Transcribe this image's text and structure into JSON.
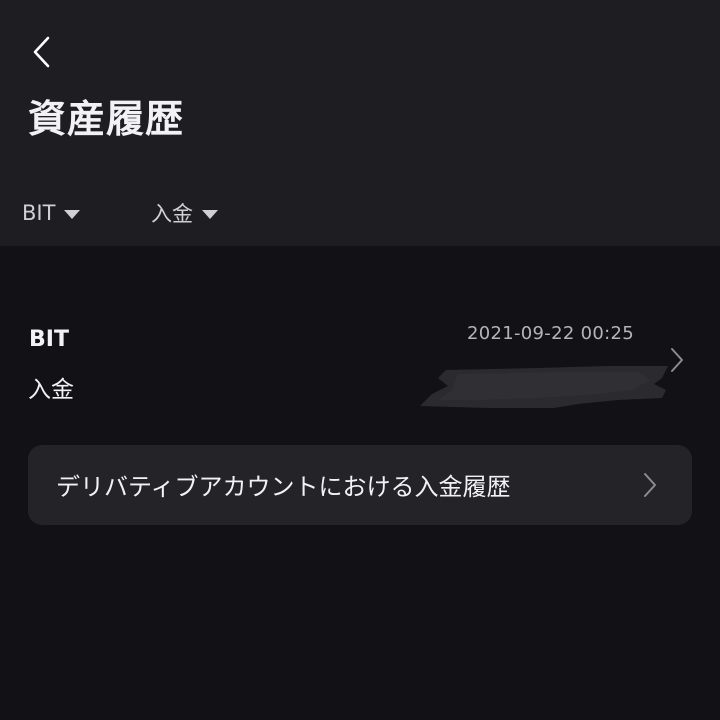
{
  "header": {
    "title": "資産履歴"
  },
  "filters": {
    "currency": "BIT",
    "type": "入金"
  },
  "record": {
    "asset": "BIT",
    "type": "入金",
    "timestamp": "2021-09-22 00:25"
  },
  "derivatives_link": {
    "label": "デリバティブアカウントにおける入金履歴"
  },
  "colors": {
    "background": "#121116",
    "header_background": "#1e1d22",
    "card_background": "#242328"
  },
  "icons": {
    "back": "chevron-left-icon",
    "dropdown": "caret-down-icon",
    "row_arrow": "chevron-right-icon"
  }
}
